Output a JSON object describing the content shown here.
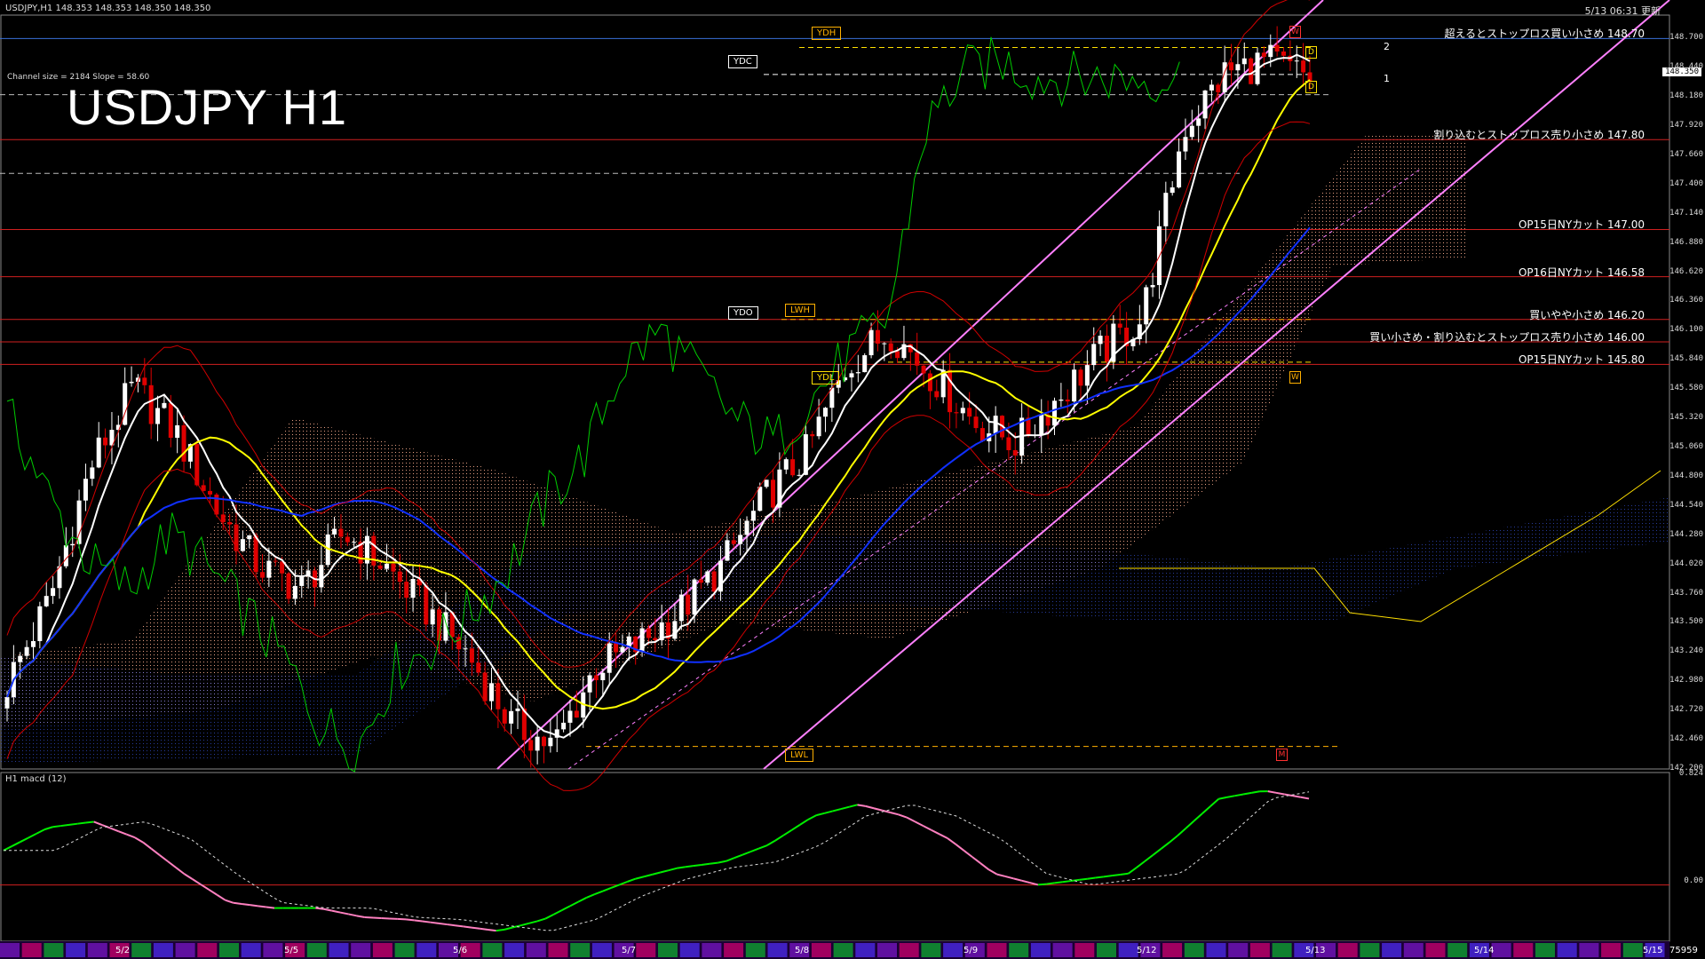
{
  "header": {
    "symbol_info": "USDJPY,H1  148.353 148.353 148.350 148.350",
    "updated": "5/13 06:31 更新",
    "channel_info": "Channel size = 2184 Slope = 58.60",
    "big_title": "USDJPY H1",
    "current_price": "148.350"
  },
  "macd": {
    "title": "H1  macd (12)",
    "top": "0.824",
    "zero": "0.00"
  },
  "levels": [
    {
      "price": 148.7,
      "text": "超えるとストップロス買い小さめ 148.70",
      "color": "#3a6fd8"
    },
    {
      "price": 147.8,
      "text": "割り込むとストップロス売り小さめ 147.80",
      "color": "#d02020"
    },
    {
      "price": 147.0,
      "text": "OP15日NYカット 147.00",
      "color": "#d02020"
    },
    {
      "price": 146.58,
      "text": "OP16日NYカット 146.58",
      "color": "#d02020"
    },
    {
      "price": 146.2,
      "text": "買いやや小さめ 146.20",
      "color": "#d02020"
    },
    {
      "price": 146.0,
      "text": "買い小さめ・割り込むとストップロス売り小さめ 146.00",
      "color": "#d02020"
    },
    {
      "price": 145.8,
      "text": "OP15日NYカット 145.80",
      "color": "#d02020"
    }
  ],
  "tags": {
    "ydh": "YDH",
    "ydc": "YDC",
    "ydo": "YDO",
    "lwh": "LWH",
    "ydl": "YDL",
    "lwl": "LWL",
    "w_top": "W",
    "d1": "D",
    "d2": "D",
    "w_mid": "W",
    "m_bot": "M"
  },
  "channel_labels": {
    "one": "1",
    "two": "2"
  },
  "axis": {
    "y_ticks": [
      "148.700",
      "148.440",
      "148.180",
      "147.920",
      "147.660",
      "147.400",
      "147.140",
      "146.880",
      "146.620",
      "146.360",
      "146.100",
      "145.840",
      "145.580",
      "145.320",
      "145.060",
      "144.800",
      "144.540",
      "144.280",
      "144.020",
      "143.760",
      "143.500",
      "143.240",
      "142.980",
      "142.720",
      "142.460",
      "142.200"
    ],
    "x_labels": [
      "5/2",
      "5/5",
      "5/6",
      "5/7",
      "5/8",
      "5/9",
      "5/12",
      "5/13",
      "5/14",
      "5/15"
    ],
    "corner": "75959"
  },
  "colors": {
    "bull": "#ffffff",
    "bear": "#e00000",
    "ma_white": "#ffffff",
    "ma_yellow": "#ffff00",
    "ma_blue": "#1030ff",
    "bollinger": "#d00000",
    "chikou": "#00cc00",
    "channel": "#ff80ff",
    "macd_up": "#00ee00",
    "macd_down": "#ff80c0"
  },
  "chart_data": {
    "type": "candlestick",
    "title": "USDJPY H1",
    "ylim": [
      142.2,
      148.9
    ],
    "x": [
      "5/2",
      "5/5",
      "5/6",
      "5/7",
      "5/8",
      "5/9",
      "5/12",
      "5/13",
      "5/14",
      "5/15"
    ],
    "close_path": [
      142.95,
      143.7,
      144.9,
      145.6,
      145.2,
      144.5,
      144.0,
      143.8,
      144.3,
      144.0,
      143.6,
      143.2,
      142.6,
      142.4,
      143.1,
      143.3,
      143.6,
      144.0,
      144.6,
      145.0,
      145.8,
      146.1,
      145.7,
      145.3,
      145.1,
      145.5,
      145.9,
      146.2,
      147.9,
      148.4,
      148.5,
      148.35
    ],
    "last_price": 148.35,
    "macd_path": [
      0.3,
      0.5,
      0.55,
      0.4,
      0.1,
      -0.15,
      -0.2,
      -0.2,
      -0.28,
      -0.3,
      -0.35,
      -0.4,
      -0.3,
      -0.1,
      0.05,
      0.15,
      0.2,
      0.35,
      0.6,
      0.7,
      0.6,
      0.4,
      0.1,
      0.0,
      0.05,
      0.1,
      0.4,
      0.75,
      0.82,
      0.75
    ]
  }
}
